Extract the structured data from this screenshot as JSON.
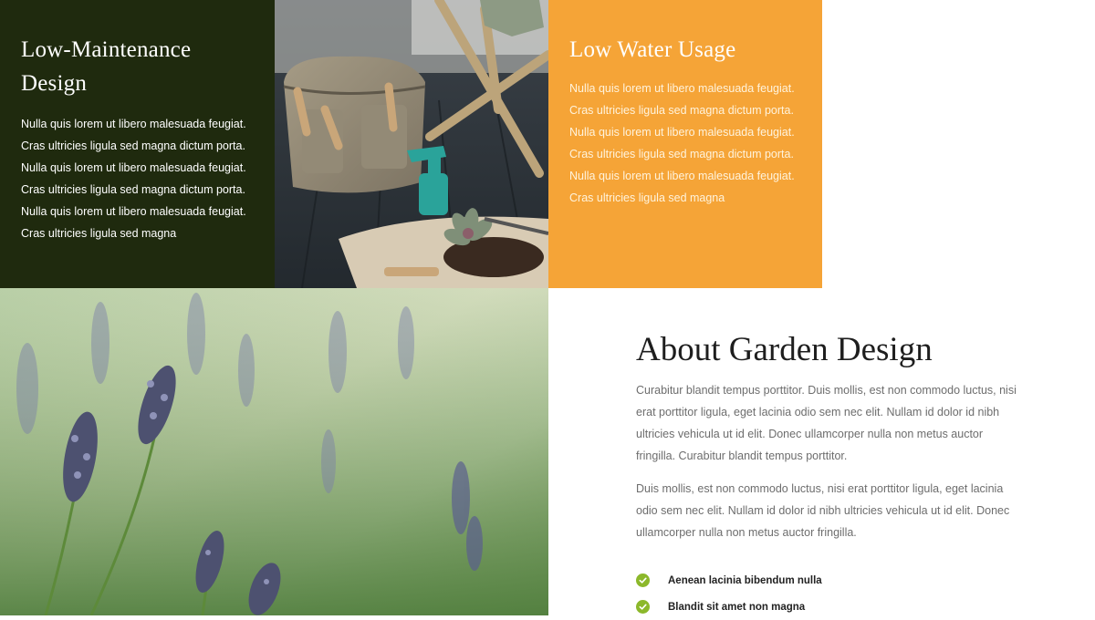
{
  "cards": [
    {
      "title_line1": "Low-Maintenance",
      "title_line2": "Design",
      "text": "Nulla quis lorem ut libero malesuada feugiat. Cras ultricies ligula sed magna dictum porta. Nulla quis lorem ut libero malesuada feugiat. Cras ultricies ligula sed magna dictum porta. Nulla quis lorem ut libero malesuada feugiat. Cras ultricies ligula sed magna",
      "bg_color": "#1f2a0e"
    },
    {
      "title": "Low Water Usage",
      "text": "Nulla quis lorem ut libero malesuada feugiat. Cras ultricies ligula sed magna dictum porta. Nulla quis lorem ut libero malesuada feugiat. Cras ultricies ligula sed magna dictum porta. Nulla quis lorem ut libero malesuada feugiat. Cras ultricies ligula sed magna",
      "bg_color": "#f5a437"
    }
  ],
  "about": {
    "title": "About Garden Design",
    "paragraphs": [
      "Curabitur blandit tempus porttitor. Duis mollis, est non commodo luctus, nisi erat porttitor ligula, eget lacinia odio sem nec elit. Nullam id dolor id nibh ultricies vehicula ut id elit. Donec ullamcorper nulla non metus auctor fringilla. Curabitur blandit tempus porttitor.",
      "Duis mollis, est non commodo luctus, nisi erat porttitor ligula, eget lacinia odio sem nec elit. Nullam id dolor id nibh ultricies vehicula ut id elit. Donec ullamcorper nulla non metus auctor fringilla."
    ],
    "features": [
      {
        "label": "Aenean lacinia bibendum nulla",
        "icon": "check-circle-icon"
      },
      {
        "label": "Blandit sit amet non magna",
        "icon": "check-circle-icon"
      }
    ],
    "accent_color": "#8cb82b"
  }
}
